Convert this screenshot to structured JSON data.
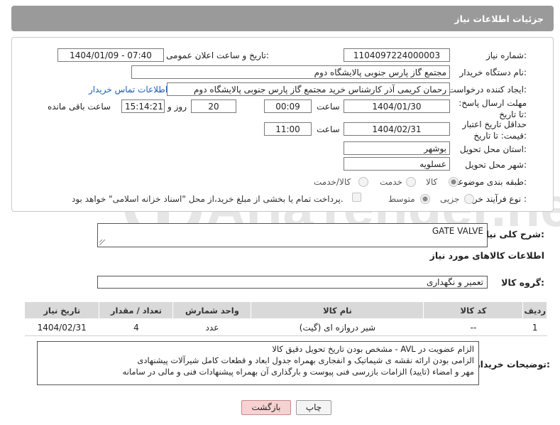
{
  "page": {
    "title": "جزئیات اطلاعات نیاز"
  },
  "form": {
    "need_number": {
      "label": "شماره نیاز:",
      "value": "1104097224000003"
    },
    "announce_datetime": {
      "label": "تاریخ و ساعت اعلان عمومی:",
      "value": "1404/01/09 - 07:40"
    },
    "buyer_org": {
      "label": "نام دستگاه خریدار:",
      "value": "مجتمع گاز پارس جنوبی  پالایشگاه دوم"
    },
    "requester": {
      "label": "ایجاد کننده درخواست:",
      "value": "رحمان کریمی آذر کارشناس خرید مجتمع گاز پارس جنوبی  پالایشگاه دوم",
      "contact_link": "اطلاعات تماس خریدار"
    },
    "deadline": {
      "label": "مهلت ارسال پاسخ: تا تاریخ:",
      "date": "1404/01/30",
      "time_label": "ساعت",
      "time": "00:09",
      "days": "20",
      "days_label": "روز و",
      "remaining": "15:14:21",
      "remaining_label": "ساعت باقی مانده"
    },
    "price_validity": {
      "label": "حداقل تاریخ اعتبار قیمت: تا تاریخ:",
      "date": "1404/02/31",
      "time_label": "ساعت",
      "time": "11:00"
    },
    "province": {
      "label": "استان محل تحویل:",
      "value": "بوشهر"
    },
    "city": {
      "label": "شهر محل تحویل:",
      "value": "عسلویه"
    },
    "category": {
      "label": "طبقه بندی موضوعی:",
      "options": [
        "کالا",
        "خدمت",
        "کالا/خدمت"
      ],
      "selected": "کالا"
    },
    "purchase_type": {
      "label": "نوع فرآیند خرید :",
      "options": [
        "جزیی",
        "متوسط"
      ],
      "selected": "متوسط",
      "note": "پرداخت تمام یا بخشی از مبلغ خرید،از محل \"اسناد خزانه اسلامی\" خواهد بود."
    }
  },
  "summary": {
    "label": "شرح کلی نیاز:",
    "value": "GATE VALVE"
  },
  "goods_info_title": "اطلاعات کالاهای مورد نیاز",
  "goods_group": {
    "label": "گروه کالا:",
    "value": "تعمیر و نگهداری"
  },
  "table": {
    "headers": [
      "ردیف",
      "کد کالا",
      "نام کالا",
      "واحد شمارش",
      "تعداد / مقدار",
      "تاریخ نیاز"
    ],
    "rows": [
      [
        "1",
        "--",
        "شیر دروازه ای (گیت)",
        "عدد",
        "4",
        "1404/02/31"
      ]
    ]
  },
  "buyer_notes": {
    "label": "توضیحات خریدار:",
    "lines": [
      "الزام عضویت در AVL  -  مشخص بودن تاریخ تحویل دقیق کالا",
      "الزامی بودن ارائه نقشه ی شیماتیک و انفجاری بهمراه جدول ابعاد و قطعات کامل شیرآلات پیشنهادی",
      "مهر و امضاء (تایید) الزامات بازرسی فنی پیوست و بارگذاری آن بهمراه پیشنهادات فنی و مالی در سامانه"
    ]
  },
  "buttons": {
    "print": "چاپ",
    "back": "بازگشت"
  },
  "watermark": "AriaTender.neT",
  "colors": {
    "header": "#9a9a9a",
    "link": "#1a5fb4",
    "back_button": "#f7d2d2"
  }
}
